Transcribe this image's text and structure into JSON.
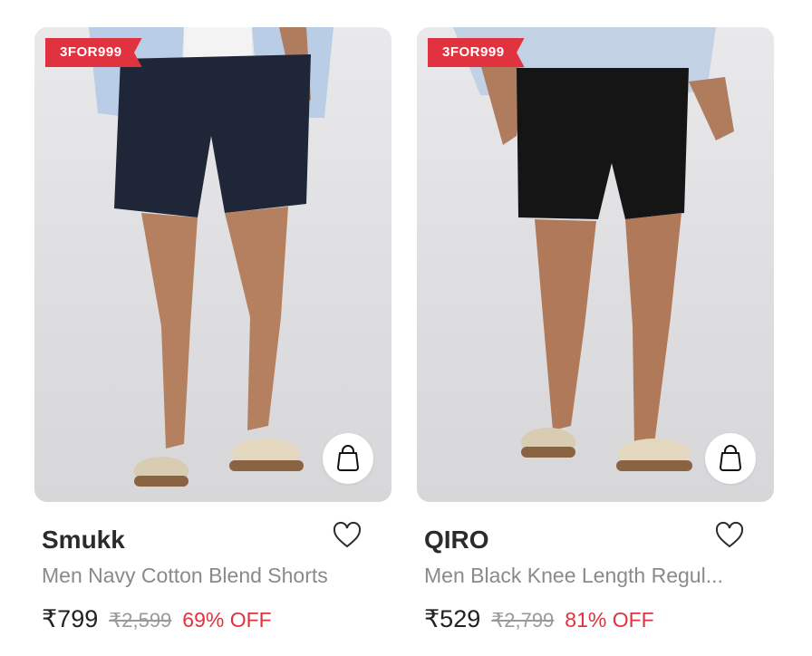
{
  "products": [
    {
      "badge": "3FOR999",
      "brand": "Smukk",
      "title": "Men Navy Cotton Blend Shorts",
      "price": "₹799",
      "mrp": "₹2,599",
      "discount": "69% OFF",
      "shorts_color": "#1f2638",
      "shirt_color": "#b9cde6"
    },
    {
      "badge": "3FOR999",
      "brand": "QIRO",
      "title": "Men Black Knee Length Regul...",
      "price": "₹529",
      "mrp": "₹2,799",
      "discount": "81% OFF",
      "shorts_color": "#151515",
      "shirt_color": "#c2d1e4"
    }
  ],
  "colors": {
    "badge": "#e0323f",
    "discount": "#e0323f"
  },
  "icons": {
    "bag": "shopping-bag-icon",
    "wishlist": "heart-outline-icon"
  }
}
